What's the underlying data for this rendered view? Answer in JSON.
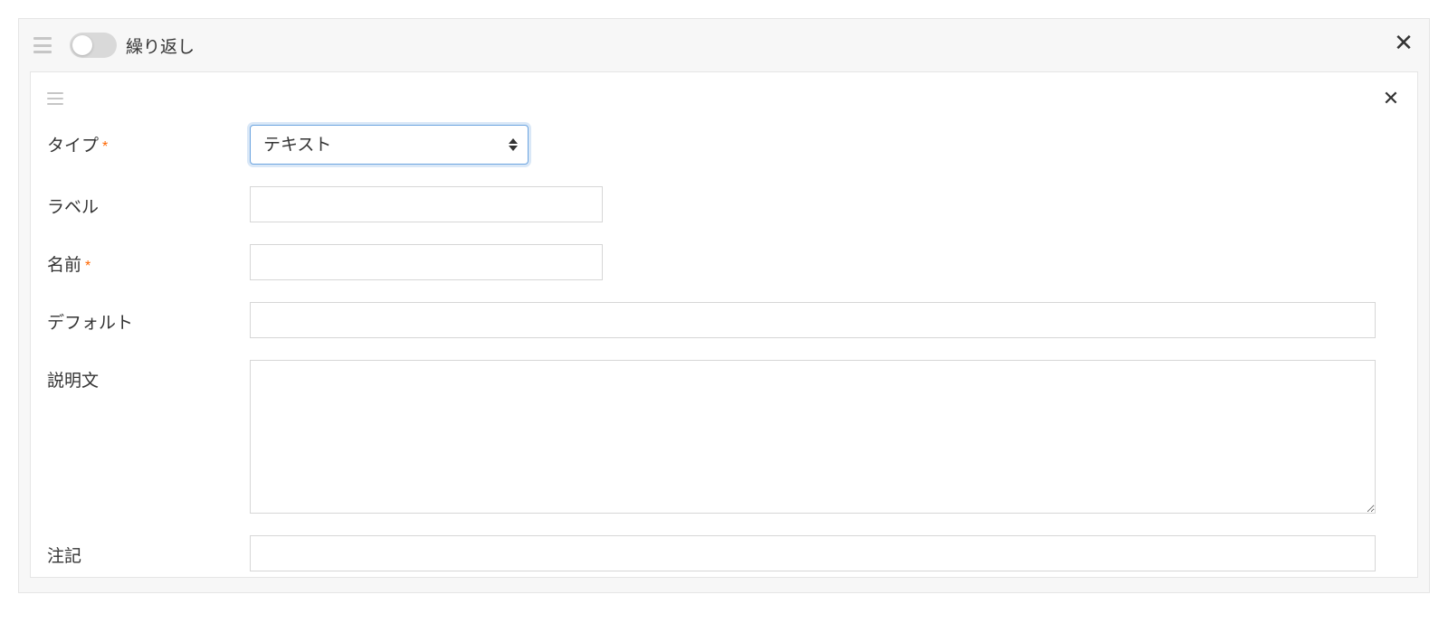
{
  "outer": {
    "toggle_label": "繰り返し",
    "toggle_on": false
  },
  "form": {
    "type": {
      "label": "タイプ",
      "required": true,
      "selected": "テキスト"
    },
    "label_field": {
      "label": "ラベル",
      "required": false,
      "value": ""
    },
    "name": {
      "label": "名前",
      "required": true,
      "value": ""
    },
    "default": {
      "label": "デフォルト",
      "required": false,
      "value": ""
    },
    "description": {
      "label": "説明文",
      "required": false,
      "value": ""
    },
    "note": {
      "label": "注記",
      "required": false,
      "value": ""
    }
  }
}
